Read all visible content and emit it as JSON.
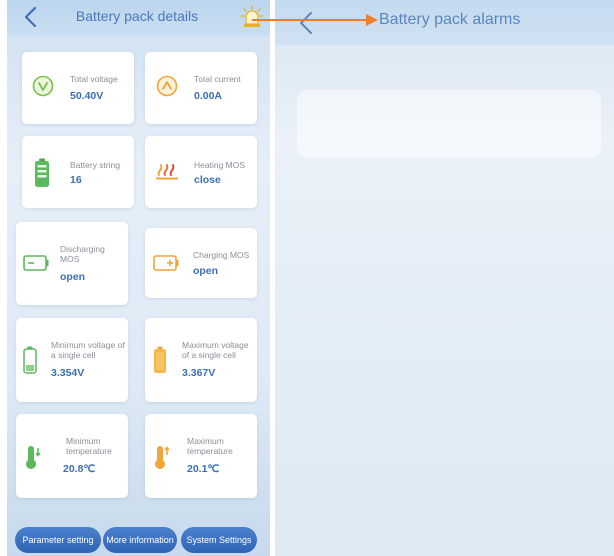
{
  "left_screen": {
    "title": "Battery pack details",
    "cards": [
      {
        "label": "Total voltage",
        "value": "50.40V",
        "icon": "voltage-icon"
      },
      {
        "label": "Total current",
        "value": "0.00A",
        "icon": "current-icon"
      },
      {
        "label": "Battery string",
        "value": "16",
        "icon": "battery-string-icon"
      },
      {
        "label": "Heating MOS",
        "value": "close",
        "icon": "heating-icon"
      },
      {
        "label": "Discharging MOS",
        "value": "open",
        "icon": "discharging-battery-icon"
      },
      {
        "label": "Charging MOS",
        "value": "open",
        "icon": "charging-battery-icon"
      },
      {
        "label": "Minimum voltage of a single cell",
        "value": "3.354V",
        "icon": "min-cell-battery-icon"
      },
      {
        "label": "Maximum voltage of a single cell",
        "value": "3.367V",
        "icon": "max-cell-battery-icon"
      },
      {
        "label": "Minimum temperature",
        "value": "20.8℃",
        "icon": "min-temperature-icon"
      },
      {
        "label": "Maximum temperature",
        "value": "20.1℃",
        "icon": "max-temperature-icon"
      }
    ],
    "buttons": {
      "parameter_setting": "Parameter setting",
      "more_information": "More information",
      "system_settings": "System Settings"
    }
  },
  "right_screen": {
    "title": "Battery pack alarms"
  },
  "colors": {
    "accent": "#3b6fb4",
    "annotation_arrow": "#f07d2a",
    "label_gray": "#8a8f98"
  }
}
